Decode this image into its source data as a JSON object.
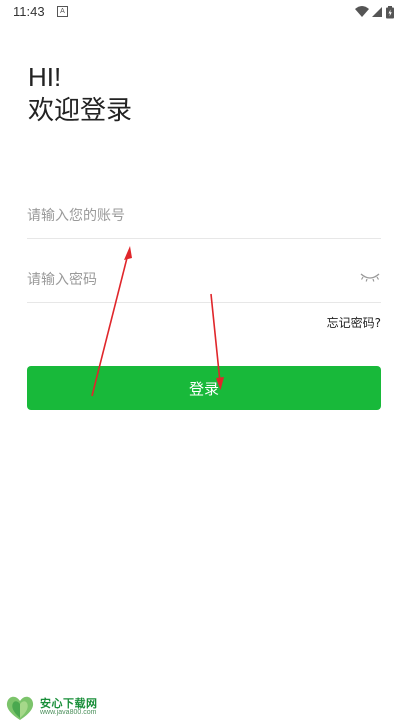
{
  "status_bar": {
    "time": "11:43",
    "notification_icon": "A",
    "icons": [
      "wifi-icon",
      "signal-icon",
      "battery-icon"
    ]
  },
  "headline": {
    "line1": "HI!",
    "line2": "欢迎登录"
  },
  "form": {
    "account_placeholder": "请输入您的账号",
    "account_value": "",
    "password_placeholder": "请输入密码",
    "password_value": "",
    "password_toggle_icon": "eye-closed-icon",
    "forgot_label": "忘记密码?",
    "login_label": "登录"
  },
  "colors": {
    "primary": "#18b93a",
    "annotation_arrow": "#e0262b"
  },
  "watermark": {
    "name": "安心下载网",
    "url": "www.java800.com",
    "logo_icon": "heart-leaf-logo"
  }
}
